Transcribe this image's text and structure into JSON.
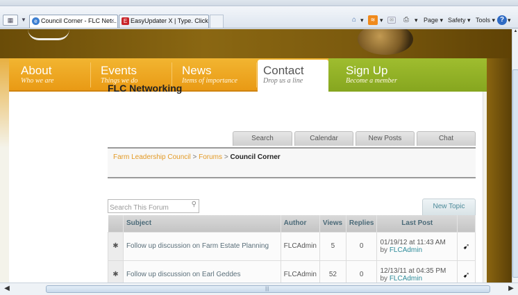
{
  "browser": {
    "tabs": [
      {
        "title": "Council Corner - FLC Net...",
        "active": true
      },
      {
        "title": "EasyUpdater X | Type. Click. ...",
        "active": false
      }
    ],
    "tab_close_glyph": "×",
    "toolbar": {
      "home_icon": "home-icon",
      "feeds_icon": "rss-feed-icon",
      "mail_icon": "mail-icon",
      "print_icon": "printer-icon",
      "page_menu": "Page ▾",
      "safety_menu": "Safety ▾",
      "tools_menu": "Tools ▾",
      "help_icon": "help-icon"
    }
  },
  "nav": {
    "items": [
      {
        "label": "About",
        "sub": "Who we are"
      },
      {
        "label": "Events",
        "sub": "Things we do"
      },
      {
        "label": "News",
        "sub": "Items of importance"
      },
      {
        "label": "Contact",
        "sub": "Drop us a line"
      },
      {
        "label": "Sign Up",
        "sub": "Become a member"
      }
    ],
    "active": "Contact",
    "colors": {
      "orange": "#f2b531",
      "green": "#9fbd2f",
      "text_active": "#555555"
    }
  },
  "page": {
    "title": "FLC Networking",
    "sub_tabs": [
      "Search",
      "Calendar",
      "New Posts",
      "Chat"
    ],
    "breadcrumb": {
      "links": [
        "Farm Leadership Council",
        "Forums"
      ],
      "separator": ">",
      "current": "Council Corner"
    },
    "search": {
      "placeholder": "Search This Forum"
    },
    "new_topic_label": "New Topic"
  },
  "table": {
    "columns": [
      "Subject",
      "Author",
      "Views",
      "Replies",
      "Last Post"
    ],
    "rows": [
      {
        "subject": "Follow up discussion on Farm Estate Planning",
        "author": "FLCAdmin",
        "views": "5",
        "replies": "0",
        "last_post_date": "01/19/12 at 11:43 AM",
        "last_post_by": "by",
        "last_post_user": "FLCAdmin"
      },
      {
        "subject": "Follow up discussion on Earl Geddes",
        "author": "FLCAdmin",
        "views": "52",
        "replies": "0",
        "last_post_date": "12/13/11 at 04:35 PM",
        "last_post_by": "by",
        "last_post_user": "FLCAdmin"
      }
    ]
  }
}
